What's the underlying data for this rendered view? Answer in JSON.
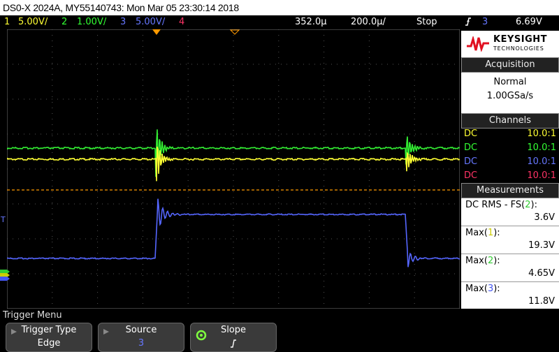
{
  "titlebar": {
    "text": "DS0-X 2024A, MY55140743: Mon Mar 05 23:30:14 2018"
  },
  "status": {
    "ch1": {
      "num": "1",
      "scale": "5.00V/",
      "color": "#ffff33"
    },
    "ch2": {
      "num": "2",
      "scale": "1.00V/",
      "color": "#33ff33"
    },
    "ch3": {
      "num": "3",
      "scale": "5.00V/",
      "color": "#6677ff"
    },
    "ch4": {
      "num": "4",
      "color": "#ff3366"
    },
    "delay": "352.0µ",
    "timebase": "200.0µ/",
    "run_state": "Stop",
    "trigger_source": "3",
    "trigger_level": "6.69V"
  },
  "brand": {
    "name": "KEYSIGHT",
    "sub": "TECHNOLOGIES",
    "color": "#e01020"
  },
  "acquisition": {
    "header": "Acquisition",
    "mode": "Normal",
    "rate": "1.00GSa/s"
  },
  "channels": {
    "header": "Channels",
    "rows": [
      {
        "coupling": "DC",
        "probe": "10.0:1",
        "color": "#ffff33"
      },
      {
        "coupling": "DC",
        "probe": "10.0:1",
        "color": "#33ff33"
      },
      {
        "coupling": "DC",
        "probe": "10.0:1",
        "color": "#6677ff"
      },
      {
        "coupling": "DC",
        "probe": "10.0:1",
        "color": "#ff3366"
      }
    ]
  },
  "measurements": {
    "header": "Measurements",
    "items": [
      {
        "label": "DC RMS - FS(",
        "ch": "2",
        "suffix": "):",
        "value": "3.6V",
        "chcolor": "#33cc33"
      },
      {
        "label": "Max(",
        "ch": "1",
        "suffix": "):",
        "value": "19.3V",
        "chcolor": "#cccc00"
      },
      {
        "label": "Max(",
        "ch": "2",
        "suffix": "):",
        "value": "4.65V",
        "chcolor": "#33cc33"
      },
      {
        "label": "Max(",
        "ch": "3",
        "suffix": "):",
        "value": "11.8V",
        "chcolor": "#4455ee"
      }
    ]
  },
  "menu": {
    "title": "Trigger Menu",
    "softkeys": [
      {
        "label": "Trigger Type",
        "value": "Edge"
      },
      {
        "label": "Source",
        "value": "3"
      },
      {
        "label": "Slope",
        "value": "⭍"
      }
    ]
  },
  "markers": {
    "ground_3": "T",
    "trigger_level_color": "#ff9900"
  }
}
